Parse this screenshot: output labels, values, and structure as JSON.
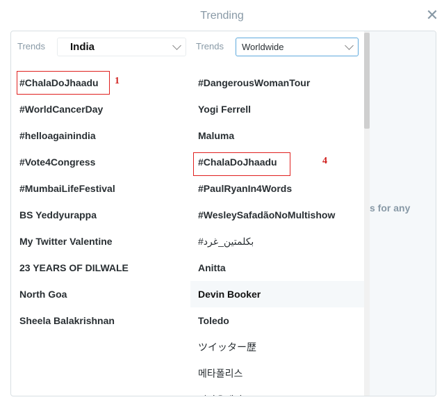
{
  "dialog": {
    "title": "Trending",
    "close_glyph": "✕"
  },
  "left": {
    "label": "Trends",
    "location": "India",
    "trends": [
      "#ChalaDoJhaadu",
      "#WorldCancerDay",
      "#helloagainindia",
      "#Vote4Congress",
      "#MumbaiLifeFestival",
      "BS Yeddyurappa",
      "My Twitter Valentine",
      "23 YEARS OF DILWALE",
      "North Goa",
      "Sheela Balakrishnan"
    ],
    "marker": "1"
  },
  "middle": {
    "label": "Trends",
    "location": "Worldwide",
    "trends": [
      "#DangerousWomanTour",
      "Yogi Ferrell",
      "Maluma",
      "#ChalaDoJhaadu",
      "#PaulRyanIn4Words",
      "#WesleySafadãoNoMultishow",
      "#بكلمتين_غرد",
      "Anitta",
      "Devin Booker",
      "Toledo",
      "ツイッター歴",
      "메타폴리스",
      "김나운제작도"
    ],
    "marker": "4"
  },
  "right": {
    "partial_text": "s for any"
  },
  "colors": {
    "highlight": "#e0201e",
    "muted": "#8899a6",
    "accent": "#5ea9dd"
  }
}
